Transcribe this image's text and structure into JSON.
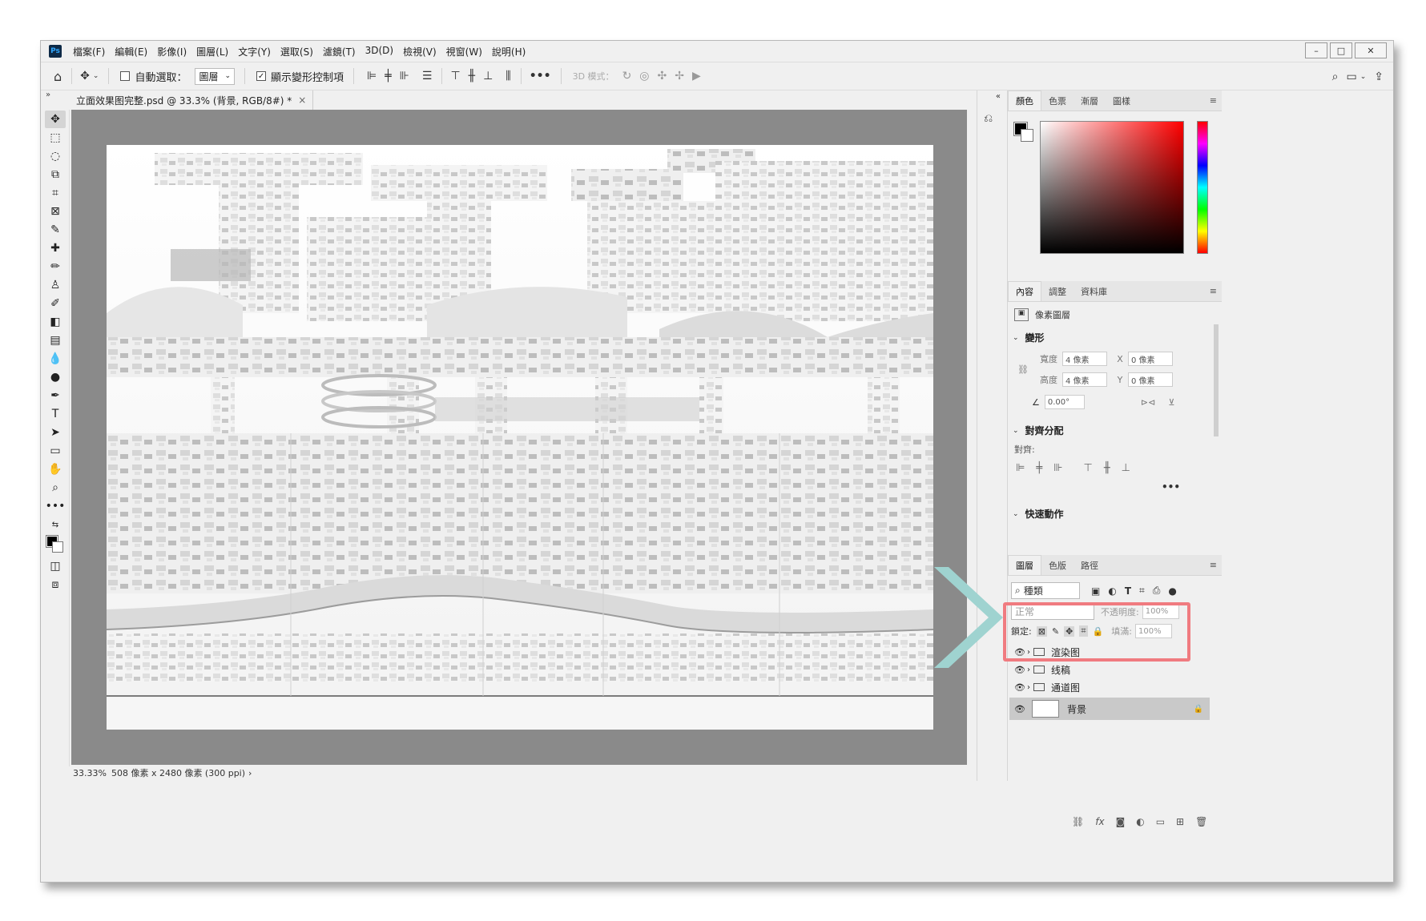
{
  "menubar": {
    "logo": "Ps",
    "items": [
      "檔案(F)",
      "編輯(E)",
      "影像(I)",
      "圖層(L)",
      "文字(Y)",
      "選取(S)",
      "濾鏡(T)",
      "3D(D)",
      "檢視(V)",
      "視窗(W)",
      "說明(H)"
    ],
    "window_controls": [
      "–",
      "□",
      "✕"
    ]
  },
  "options": {
    "auto_select_label": "自動選取：",
    "auto_select_target": "圖層",
    "show_transform_label": "顯示變形控制項",
    "mode_3d_label": "3D 模式："
  },
  "document": {
    "tab_title": "立面效果图完整.psd @ 33.3% (背景, RGB/8#) *",
    "tab_close": "×",
    "status_zoom": "33.33%",
    "status_info": "508 像素 x 2480 像素 (300 ppi)"
  },
  "color_panel": {
    "tabs": [
      "顏色",
      "色票",
      "漸層",
      "圖樣"
    ],
    "foreground": "#000000",
    "background": "#ffffff"
  },
  "properties_panel": {
    "tabs": [
      "內容",
      "調整",
      "資料庫"
    ],
    "layer_type": "像素圖層",
    "transform": {
      "header": "變形",
      "width_label": "寬度",
      "width_value": "4 像素",
      "height_label": "高度",
      "height_value": "4 像素",
      "x_label": "X",
      "x_value": "0 像素",
      "y_label": "Y",
      "y_value": "0 像素",
      "angle_value": "0.00°"
    },
    "align": {
      "header": "對齊分配",
      "label": "對齊:"
    },
    "quick_actions_header": "快速動作"
  },
  "layers_panel": {
    "tabs": [
      "圖層",
      "色版",
      "路徑"
    ],
    "filter_kind": "種類",
    "blend_mode": "正常",
    "opacity_label": "不透明度:",
    "opacity_value": "100%",
    "lock_label": "鎖定:",
    "fill_label": "填滿:",
    "fill_value": "100%",
    "layers": [
      {
        "name": "渲染图",
        "type": "group"
      },
      {
        "name": "线稿",
        "type": "group"
      },
      {
        "name": "通道图",
        "type": "group"
      },
      {
        "name": "背景",
        "type": "pixel",
        "locked": true
      }
    ]
  },
  "colors": {
    "highlight_box": "#f07b80",
    "arrow": "#9fd3d0"
  }
}
